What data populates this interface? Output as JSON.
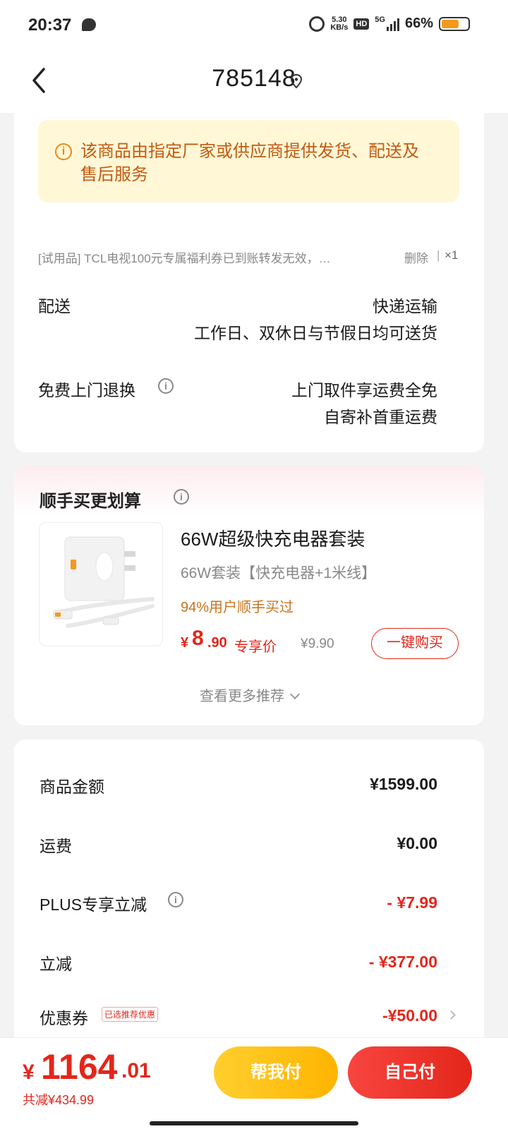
{
  "status_bar": {
    "time": "20:37",
    "net_speed_value": "5.30",
    "net_speed_unit": "KB/s",
    "hd_label": "HD",
    "network_label": "5G",
    "battery_text": "66%"
  },
  "header": {
    "title": "785148"
  },
  "notice": {
    "icon_glyph": "i",
    "text": "该商品由指定厂家或供应商提供发货、配送及售后服务"
  },
  "trial_item": {
    "text": "[试用品]  TCL电视100元专属福利券已到账转发无效，…",
    "delete_label": "删除",
    "separator": "|",
    "quantity": "×1"
  },
  "delivery": {
    "label": "配送",
    "method": "快递运输",
    "schedule": "工作日、双休日与节假日均可送货"
  },
  "return_service": {
    "label": "免费上门退换",
    "line1": "上门取件享运费全免",
    "line2": "自寄补首重运费"
  },
  "recommend": {
    "title": "顺手买更划算",
    "product_name": "66W超级快充电器套装",
    "product_spec": "66W套装【快充电器+1米线】",
    "social_proof": "94%用户顺手买过",
    "price_currency": "¥",
    "price_int": "8",
    "price_dec": ".90",
    "price_tag": "专享价",
    "original_price": "¥9.90",
    "buy_button": "一键购买",
    "more_label": "查看更多推荐"
  },
  "fees": {
    "items": [
      {
        "label": "商品金额",
        "value": "¥1599.00"
      },
      {
        "label": "运费",
        "value": "¥0.00"
      },
      {
        "label": "PLUS专享立减",
        "value": "- ¥7.99"
      },
      {
        "label": "立减",
        "value": "- ¥377.00"
      },
      {
        "label": "优惠券",
        "value": "-¥50.00"
      }
    ],
    "coupon_badge": "已选推荐优惠"
  },
  "bottom": {
    "currency": "¥",
    "total_int": "1164",
    "total_dec": ".01",
    "saved": "共减¥434.99",
    "help_pay": "帮我付",
    "self_pay": "自己付"
  },
  "colors": {
    "accent_red": "#e3261b",
    "notice_bg": "#fff7d6",
    "notice_text": "#c25b12",
    "help_pay_yellow": "#ffb400"
  }
}
